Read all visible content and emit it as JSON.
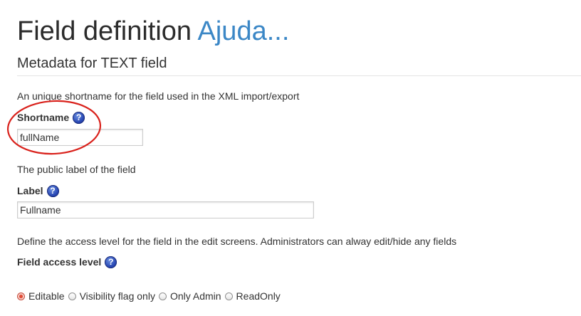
{
  "header": {
    "title": "Field definition",
    "help_link": "Ajuda..."
  },
  "section": {
    "heading": "Metadata for TEXT field"
  },
  "fields": {
    "shortname": {
      "description": "An unique shortname for the field used in the XML import/export",
      "label": "Shortname",
      "value": "fullName"
    },
    "label": {
      "description": "The public label of the field",
      "label": "Label",
      "value": "Fullname"
    },
    "access": {
      "description": "Define the access level for the field in the edit screens. Administrators can alway edit/hide any fields",
      "label": "Field access level",
      "options": [
        {
          "label": "Editable",
          "checked": true
        },
        {
          "label": "Visibility flag only",
          "checked": false
        },
        {
          "label": "Only Admin",
          "checked": false
        },
        {
          "label": "ReadOnly",
          "checked": false
        }
      ]
    }
  },
  "icons": {
    "help": "question-mark-icon",
    "help_glyph": "?"
  },
  "colors": {
    "link": "#3b87c6",
    "annotation": "#d9211b",
    "radio_checked": "#e04a35",
    "help_icon": "#2746b3"
  }
}
